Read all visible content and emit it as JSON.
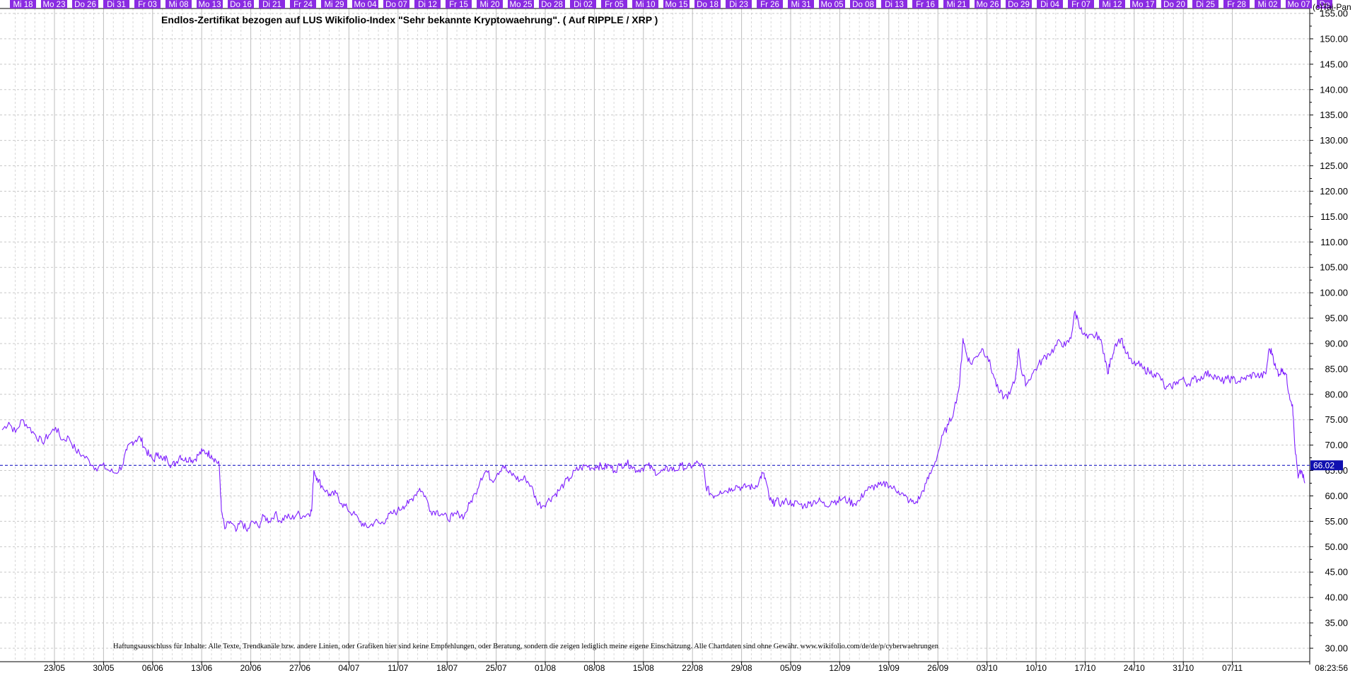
{
  "chart_data": {
    "type": "line",
    "title": "Endlos-Zertifikat bezogen auf LUS Wikifolio-Index \"Sehr bekannte Kryptowaehrung\". ( Auf RIPPLE / XRP )",
    "copyright": "(c)Tai-Pan",
    "disclaimer": "Haftungsausschluss für Inhalte: Alle Texte, Trendkanäle bzw. andere Linien, oder Grafiken hier sind keine Empfehlungen, oder Beratung, sondern die zeigen lediglich meine eigene Einschätzung. Alle Chartdaten sind ohne Gewähr. www.wikifolio.com/de/de/p/cyberwaehrungen",
    "time_label": "08:23:56",
    "current_value_label": "66.02",
    "current_value": 66.02,
    "top_day_labels": [
      "Mi 18",
      "Mo 23",
      "Do 26",
      "Di 31",
      "Fr 03",
      "Mi 08",
      "Mo 13",
      "Do 16",
      "Di 21",
      "Fr 24",
      "Mi 29",
      "Mo 04",
      "Do 07",
      "Di 12",
      "Fr 15",
      "Mi 20",
      "Mo 25",
      "Do 28",
      "Di 02",
      "Fr 05",
      "Mi 10",
      "Mo 15",
      "Do 18",
      "Di 23",
      "Fr 26",
      "Mi 31",
      "Mo 05",
      "Do 08",
      "Di 13",
      "Fr 16",
      "Mi 21",
      "Mo 26",
      "Do 29",
      "Di 04",
      "Fr 07",
      "Mi 12",
      "Mo 17",
      "Do 20",
      "Di 25",
      "Fr 28",
      "Mi 02",
      "Mo 07",
      "Do"
    ],
    "x_tick_labels": [
      "23/05",
      "30/05",
      "06/06",
      "13/06",
      "20/06",
      "27/06",
      "04/07",
      "11/07",
      "18/07",
      "25/07",
      "01/08",
      "08/08",
      "15/08",
      "22/08",
      "29/08",
      "05/09",
      "12/09",
      "19/09",
      "26/09",
      "03/10",
      "10/10",
      "17/10",
      "24/10",
      "31/10",
      "07/11"
    ],
    "ylim": [
      27.5,
      157.5
    ],
    "y_tick_labels": [
      "155.00",
      "150.00",
      "145.00",
      "140.00",
      "135.00",
      "130.00",
      "125.00",
      "120.00",
      "115.00",
      "110.00",
      "105.00",
      "100.00",
      "95.00",
      "90.00",
      "85.00",
      "80.00",
      "75.00",
      "70.00",
      "65.00",
      "60.00",
      "55.00",
      "50.00",
      "45.00",
      "40.00",
      "35.00",
      "30.00"
    ],
    "series": [
      {
        "color": "#7f1fff",
        "points": [
          [
            0.0,
            73
          ],
          [
            0.6,
            74.5
          ],
          [
            1.2,
            72.5
          ],
          [
            1.8,
            75
          ],
          [
            2.4,
            73.5
          ],
          [
            3.0,
            72
          ],
          [
            3.6,
            70.5
          ],
          [
            4.2,
            72
          ],
          [
            4.8,
            73.5
          ],
          [
            5.4,
            71
          ],
          [
            6.0,
            71.5
          ],
          [
            6.6,
            69
          ],
          [
            7.2,
            68
          ],
          [
            7.8,
            67
          ],
          [
            8.4,
            65.5
          ],
          [
            9.0,
            66
          ],
          [
            9.6,
            65
          ],
          [
            10.2,
            64.5
          ],
          [
            10.8,
            66
          ],
          [
            11.2,
            69
          ],
          [
            11.6,
            70.5
          ],
          [
            12.0,
            71
          ],
          [
            12.4,
            71.5
          ],
          [
            12.8,
            69.5
          ],
          [
            13.2,
            68
          ],
          [
            13.6,
            67
          ],
          [
            14.0,
            68.5
          ],
          [
            14.4,
            67
          ],
          [
            14.8,
            67.5
          ],
          [
            15.2,
            66
          ],
          [
            15.6,
            66.5
          ],
          [
            16.0,
            68
          ],
          [
            16.4,
            67
          ],
          [
            16.8,
            67.5
          ],
          [
            17.2,
            67
          ],
          [
            17.6,
            68
          ],
          [
            18.0,
            68.8
          ],
          [
            18.4,
            68.5
          ],
          [
            18.8,
            68
          ],
          [
            19.2,
            67
          ],
          [
            19.5,
            66
          ],
          [
            19.7,
            57
          ],
          [
            20.0,
            53.5
          ],
          [
            20.5,
            55
          ],
          [
            21.0,
            53
          ],
          [
            21.5,
            55
          ],
          [
            22.0,
            53
          ],
          [
            22.5,
            55
          ],
          [
            23.0,
            54
          ],
          [
            23.5,
            56
          ],
          [
            24.0,
            55
          ],
          [
            24.5,
            56.5
          ],
          [
            25.0,
            55
          ],
          [
            25.5,
            56
          ],
          [
            26.0,
            55.5
          ],
          [
            26.5,
            56.5
          ],
          [
            27.0,
            56
          ],
          [
            27.5,
            56.5
          ],
          [
            27.8,
            57
          ],
          [
            28.0,
            65
          ],
          [
            28.3,
            63.5
          ],
          [
            28.7,
            62
          ],
          [
            29.1,
            61
          ],
          [
            29.5,
            60
          ],
          [
            30.0,
            60.5
          ],
          [
            30.5,
            58.5
          ],
          [
            31.0,
            57.5
          ],
          [
            31.5,
            56.5
          ],
          [
            32.0,
            55.5
          ],
          [
            32.5,
            54
          ],
          [
            33.0,
            54
          ],
          [
            33.5,
            55
          ],
          [
            34.0,
            54.5
          ],
          [
            34.5,
            55.5
          ],
          [
            35.0,
            56.5
          ],
          [
            35.5,
            57
          ],
          [
            36.0,
            58
          ],
          [
            36.5,
            58.5
          ],
          [
            37.0,
            60
          ],
          [
            37.5,
            61.5
          ],
          [
            38.0,
            60
          ],
          [
            38.5,
            57
          ],
          [
            39.0,
            57
          ],
          [
            39.5,
            56.5
          ],
          [
            40.0,
            55.5
          ],
          [
            40.5,
            56
          ],
          [
            41.0,
            56.5
          ],
          [
            41.5,
            56
          ],
          [
            42.0,
            58.5
          ],
          [
            42.5,
            60.5
          ],
          [
            43.0,
            63.5
          ],
          [
            43.5,
            65
          ],
          [
            44.0,
            63
          ],
          [
            44.5,
            64.5
          ],
          [
            45.0,
            66
          ],
          [
            45.5,
            64.5
          ],
          [
            46.0,
            64
          ],
          [
            46.5,
            63
          ],
          [
            47.0,
            63.5
          ],
          [
            47.5,
            62
          ],
          [
            48.0,
            59
          ],
          [
            48.5,
            58
          ],
          [
            49.0,
            59
          ],
          [
            49.5,
            60
          ],
          [
            50.0,
            61
          ],
          [
            50.5,
            62.5
          ],
          [
            51.0,
            63.5
          ],
          [
            51.5,
            65
          ],
          [
            52.0,
            65.5
          ],
          [
            52.5,
            66
          ],
          [
            53.0,
            65.5
          ],
          [
            53.5,
            66
          ],
          [
            54.0,
            65.5
          ],
          [
            54.5,
            66
          ],
          [
            55.0,
            65
          ],
          [
            55.5,
            66
          ],
          [
            56.0,
            66.5
          ],
          [
            56.5,
            66
          ],
          [
            57.0,
            65
          ],
          [
            57.5,
            65.5
          ],
          [
            58.0,
            66
          ],
          [
            58.5,
            65
          ],
          [
            59.0,
            64.5
          ],
          [
            59.5,
            65
          ],
          [
            60.0,
            65.5
          ],
          [
            60.5,
            65
          ],
          [
            61.0,
            66
          ],
          [
            61.5,
            65.5
          ],
          [
            62.0,
            66
          ],
          [
            62.5,
            66.5
          ],
          [
            63.0,
            65.5
          ],
          [
            63.2,
            62
          ],
          [
            63.6,
            60.5
          ],
          [
            64.0,
            60
          ],
          [
            64.5,
            61
          ],
          [
            65.0,
            61
          ],
          [
            65.5,
            61.5
          ],
          [
            66.0,
            62
          ],
          [
            66.5,
            61.5
          ],
          [
            67.0,
            62
          ],
          [
            67.5,
            61.5
          ],
          [
            68.0,
            63
          ],
          [
            68.3,
            64.5
          ],
          [
            68.6,
            63
          ],
          [
            68.9,
            59.5
          ],
          [
            69.2,
            58.5
          ],
          [
            69.5,
            59
          ],
          [
            70.0,
            58.5
          ],
          [
            70.5,
            59
          ],
          [
            71.0,
            58.5
          ],
          [
            71.5,
            58.5
          ],
          [
            72.0,
            58
          ],
          [
            72.5,
            58.5
          ],
          [
            73.0,
            59
          ],
          [
            73.5,
            59
          ],
          [
            74.0,
            58
          ],
          [
            74.5,
            59
          ],
          [
            75.0,
            59
          ],
          [
            75.5,
            59.5
          ],
          [
            76.0,
            59
          ],
          [
            76.5,
            58.5
          ],
          [
            77.0,
            59
          ],
          [
            77.5,
            61
          ],
          [
            78.0,
            61.5
          ],
          [
            78.5,
            62
          ],
          [
            79.0,
            62
          ],
          [
            79.5,
            62.5
          ],
          [
            80.0,
            61.5
          ],
          [
            80.5,
            61
          ],
          [
            81.0,
            60
          ],
          [
            81.5,
            59
          ],
          [
            82.0,
            58.5
          ],
          [
            82.5,
            60
          ],
          [
            83.0,
            62.5
          ],
          [
            83.5,
            65
          ],
          [
            84.0,
            68
          ],
          [
            84.5,
            72
          ],
          [
            85.0,
            74
          ],
          [
            85.5,
            77
          ],
          [
            86.0,
            82
          ],
          [
            86.3,
            91
          ],
          [
            86.6,
            88
          ],
          [
            87.0,
            86
          ],
          [
            87.5,
            87.5
          ],
          [
            88.0,
            89
          ],
          [
            88.5,
            87.5
          ],
          [
            89.0,
            84
          ],
          [
            89.5,
            80.5
          ],
          [
            90.0,
            79.5
          ],
          [
            90.5,
            80
          ],
          [
            91.0,
            83
          ],
          [
            91.3,
            89
          ],
          [
            91.6,
            84
          ],
          [
            92.0,
            82
          ],
          [
            92.5,
            84
          ],
          [
            93.0,
            85.5
          ],
          [
            93.5,
            87
          ],
          [
            94.0,
            88
          ],
          [
            94.5,
            89
          ],
          [
            95.0,
            90.5
          ],
          [
            95.5,
            89.5
          ],
          [
            96.0,
            91
          ],
          [
            96.3,
            96
          ],
          [
            96.6,
            95
          ],
          [
            97.0,
            92
          ],
          [
            97.5,
            91
          ],
          [
            98.0,
            91.5
          ],
          [
            98.5,
            91.5
          ],
          [
            99.0,
            88
          ],
          [
            99.3,
            84
          ],
          [
            99.6,
            87
          ],
          [
            100.0,
            90
          ],
          [
            100.5,
            91
          ],
          [
            101.0,
            88
          ],
          [
            101.5,
            86
          ],
          [
            102.0,
            86
          ],
          [
            102.5,
            85
          ],
          [
            103.0,
            84.5
          ],
          [
            103.5,
            84
          ],
          [
            104.0,
            83.5
          ],
          [
            104.5,
            81
          ],
          [
            105.0,
            81.5
          ],
          [
            105.5,
            82.5
          ],
          [
            106.0,
            83
          ],
          [
            106.5,
            82
          ],
          [
            107.0,
            83
          ],
          [
            107.5,
            83
          ],
          [
            108.0,
            84
          ],
          [
            108.5,
            84
          ],
          [
            109.0,
            83.5
          ],
          [
            109.5,
            82.5
          ],
          [
            110.0,
            83
          ],
          [
            110.5,
            83
          ],
          [
            111.0,
            82.5
          ],
          [
            111.5,
            83
          ],
          [
            112.0,
            83.5
          ],
          [
            112.5,
            84
          ],
          [
            113.0,
            83.5
          ],
          [
            113.5,
            84
          ],
          [
            113.8,
            89
          ],
          [
            114.1,
            88
          ],
          [
            114.4,
            85
          ],
          [
            114.7,
            84
          ],
          [
            115.0,
            85
          ],
          [
            115.3,
            84
          ],
          [
            115.6,
            80
          ],
          [
            115.9,
            78
          ],
          [
            116.1,
            70
          ],
          [
            116.4,
            63.5
          ],
          [
            116.7,
            65
          ],
          [
            117.0,
            62.5
          ]
        ]
      }
    ],
    "grid": true,
    "reference_line": {
      "y": 66.02,
      "style": "dashed",
      "color": "#0000bb"
    }
  }
}
